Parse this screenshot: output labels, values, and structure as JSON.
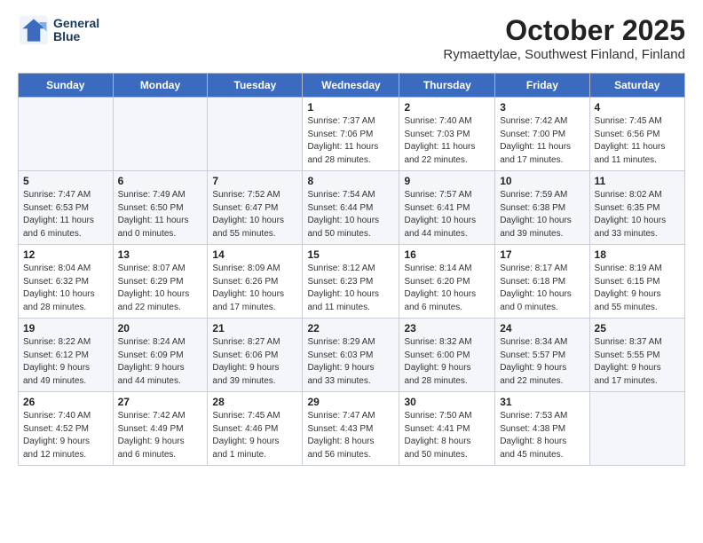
{
  "header": {
    "logo_line1": "General",
    "logo_line2": "Blue",
    "month": "October 2025",
    "location": "Rymaettylae, Southwest Finland, Finland"
  },
  "weekdays": [
    "Sunday",
    "Monday",
    "Tuesday",
    "Wednesday",
    "Thursday",
    "Friday",
    "Saturday"
  ],
  "weeks": [
    [
      {
        "day": "",
        "info": ""
      },
      {
        "day": "",
        "info": ""
      },
      {
        "day": "",
        "info": ""
      },
      {
        "day": "1",
        "info": "Sunrise: 7:37 AM\nSunset: 7:06 PM\nDaylight: 11 hours\nand 28 minutes."
      },
      {
        "day": "2",
        "info": "Sunrise: 7:40 AM\nSunset: 7:03 PM\nDaylight: 11 hours\nand 22 minutes."
      },
      {
        "day": "3",
        "info": "Sunrise: 7:42 AM\nSunset: 7:00 PM\nDaylight: 11 hours\nand 17 minutes."
      },
      {
        "day": "4",
        "info": "Sunrise: 7:45 AM\nSunset: 6:56 PM\nDaylight: 11 hours\nand 11 minutes."
      }
    ],
    [
      {
        "day": "5",
        "info": "Sunrise: 7:47 AM\nSunset: 6:53 PM\nDaylight: 11 hours\nand 6 minutes."
      },
      {
        "day": "6",
        "info": "Sunrise: 7:49 AM\nSunset: 6:50 PM\nDaylight: 11 hours\nand 0 minutes."
      },
      {
        "day": "7",
        "info": "Sunrise: 7:52 AM\nSunset: 6:47 PM\nDaylight: 10 hours\nand 55 minutes."
      },
      {
        "day": "8",
        "info": "Sunrise: 7:54 AM\nSunset: 6:44 PM\nDaylight: 10 hours\nand 50 minutes."
      },
      {
        "day": "9",
        "info": "Sunrise: 7:57 AM\nSunset: 6:41 PM\nDaylight: 10 hours\nand 44 minutes."
      },
      {
        "day": "10",
        "info": "Sunrise: 7:59 AM\nSunset: 6:38 PM\nDaylight: 10 hours\nand 39 minutes."
      },
      {
        "day": "11",
        "info": "Sunrise: 8:02 AM\nSunset: 6:35 PM\nDaylight: 10 hours\nand 33 minutes."
      }
    ],
    [
      {
        "day": "12",
        "info": "Sunrise: 8:04 AM\nSunset: 6:32 PM\nDaylight: 10 hours\nand 28 minutes."
      },
      {
        "day": "13",
        "info": "Sunrise: 8:07 AM\nSunset: 6:29 PM\nDaylight: 10 hours\nand 22 minutes."
      },
      {
        "day": "14",
        "info": "Sunrise: 8:09 AM\nSunset: 6:26 PM\nDaylight: 10 hours\nand 17 minutes."
      },
      {
        "day": "15",
        "info": "Sunrise: 8:12 AM\nSunset: 6:23 PM\nDaylight: 10 hours\nand 11 minutes."
      },
      {
        "day": "16",
        "info": "Sunrise: 8:14 AM\nSunset: 6:20 PM\nDaylight: 10 hours\nand 6 minutes."
      },
      {
        "day": "17",
        "info": "Sunrise: 8:17 AM\nSunset: 6:18 PM\nDaylight: 10 hours\nand 0 minutes."
      },
      {
        "day": "18",
        "info": "Sunrise: 8:19 AM\nSunset: 6:15 PM\nDaylight: 9 hours\nand 55 minutes."
      }
    ],
    [
      {
        "day": "19",
        "info": "Sunrise: 8:22 AM\nSunset: 6:12 PM\nDaylight: 9 hours\nand 49 minutes."
      },
      {
        "day": "20",
        "info": "Sunrise: 8:24 AM\nSunset: 6:09 PM\nDaylight: 9 hours\nand 44 minutes."
      },
      {
        "day": "21",
        "info": "Sunrise: 8:27 AM\nSunset: 6:06 PM\nDaylight: 9 hours\nand 39 minutes."
      },
      {
        "day": "22",
        "info": "Sunrise: 8:29 AM\nSunset: 6:03 PM\nDaylight: 9 hours\nand 33 minutes."
      },
      {
        "day": "23",
        "info": "Sunrise: 8:32 AM\nSunset: 6:00 PM\nDaylight: 9 hours\nand 28 minutes."
      },
      {
        "day": "24",
        "info": "Sunrise: 8:34 AM\nSunset: 5:57 PM\nDaylight: 9 hours\nand 22 minutes."
      },
      {
        "day": "25",
        "info": "Sunrise: 8:37 AM\nSunset: 5:55 PM\nDaylight: 9 hours\nand 17 minutes."
      }
    ],
    [
      {
        "day": "26",
        "info": "Sunrise: 7:40 AM\nSunset: 4:52 PM\nDaylight: 9 hours\nand 12 minutes."
      },
      {
        "day": "27",
        "info": "Sunrise: 7:42 AM\nSunset: 4:49 PM\nDaylight: 9 hours\nand 6 minutes."
      },
      {
        "day": "28",
        "info": "Sunrise: 7:45 AM\nSunset: 4:46 PM\nDaylight: 9 hours\nand 1 minute."
      },
      {
        "day": "29",
        "info": "Sunrise: 7:47 AM\nSunset: 4:43 PM\nDaylight: 8 hours\nand 56 minutes."
      },
      {
        "day": "30",
        "info": "Sunrise: 7:50 AM\nSunset: 4:41 PM\nDaylight: 8 hours\nand 50 minutes."
      },
      {
        "day": "31",
        "info": "Sunrise: 7:53 AM\nSunset: 4:38 PM\nDaylight: 8 hours\nand 45 minutes."
      },
      {
        "day": "",
        "info": ""
      }
    ]
  ]
}
